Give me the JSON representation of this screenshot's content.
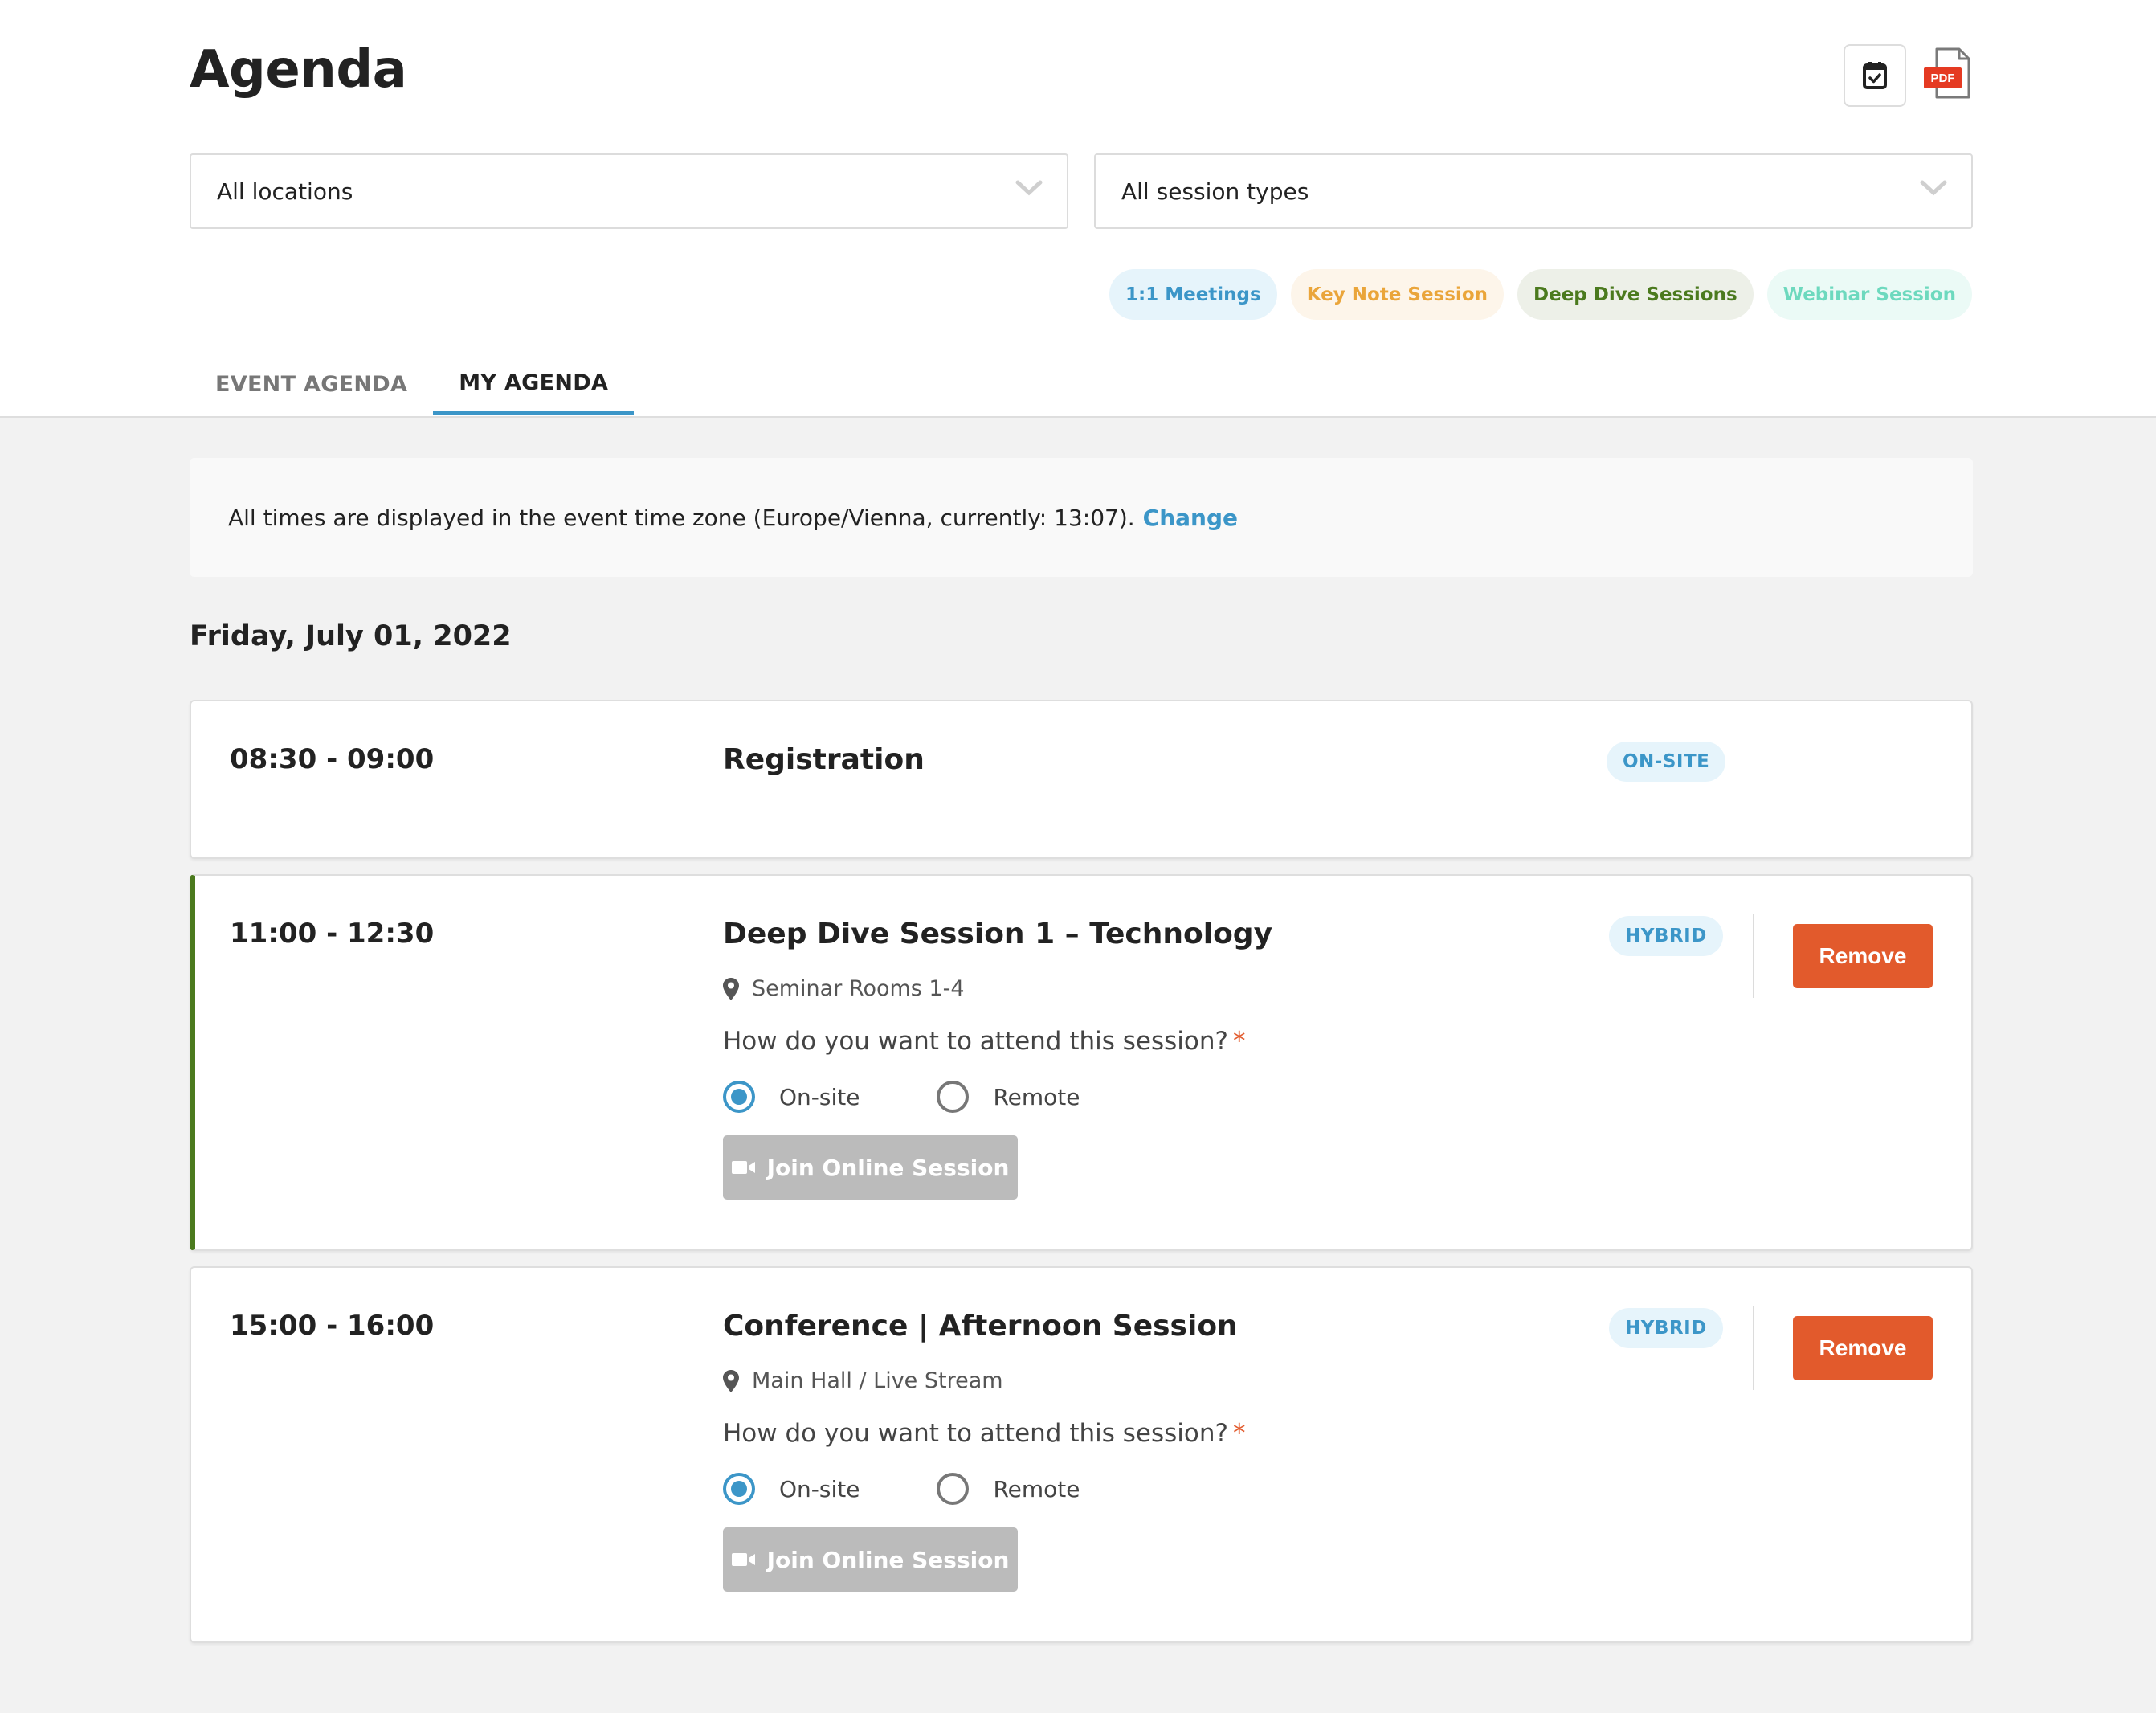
{
  "header": {
    "title": "Agenda",
    "actions": [
      {
        "icon": "calendar-check-icon",
        "label": "Add to calendar"
      },
      {
        "icon": "pdf-icon",
        "label": "PDF"
      }
    ]
  },
  "filters": {
    "location": {
      "selected": "All locations"
    },
    "session_type": {
      "selected": "All session types"
    }
  },
  "legend": [
    {
      "label": "1:1 Meetings",
      "color": "#3c96c8",
      "bg": "#e6f4fb"
    },
    {
      "label": "Key Note Session",
      "color": "#eaa53a",
      "bg": "#fdf5ea"
    },
    {
      "label": "Deep Dive Sessions",
      "color": "#4b7a1e",
      "bg": "#edf0e8"
    },
    {
      "label": "Webinar Session",
      "color": "#6dd9be",
      "bg": "#ebfaf6"
    }
  ],
  "tabs": [
    {
      "label": "EVENT AGENDA",
      "active": false
    },
    {
      "label": "MY AGENDA",
      "active": true
    }
  ],
  "timezone_notice": {
    "text": "All times are displayed in the event time zone (Europe/Vienna, currently: 13:07).",
    "link": "Change"
  },
  "date_heading": "Friday, July 01, 2022",
  "sessions": [
    {
      "time": "08:30 - 09:00",
      "title": "Registration",
      "badge": "ON-SITE"
    },
    {
      "time": "11:00 - 12:30",
      "title": "Deep Dive Session 1 – Technology",
      "badge": "HYBRID",
      "location": "Seminar Rooms 1-4",
      "question": "How do you want to attend this session?",
      "required_mark": "*",
      "options": [
        {
          "label": "On-site",
          "checked": true
        },
        {
          "label": "Remote",
          "checked": false
        }
      ],
      "join_label": "Join Online Session",
      "remove_label": "Remove",
      "accent_color": "#4b7a1e"
    },
    {
      "time": "15:00 - 16:00",
      "title": "Conference | Afternoon Session",
      "badge": "HYBRID",
      "location": "Main Hall / Live Stream",
      "question": "How do you want to attend this session?",
      "required_mark": "*",
      "options": [
        {
          "label": "On-site",
          "checked": true
        },
        {
          "label": "Remote",
          "checked": false
        }
      ],
      "join_label": "Join Online Session",
      "remove_label": "Remove"
    }
  ]
}
